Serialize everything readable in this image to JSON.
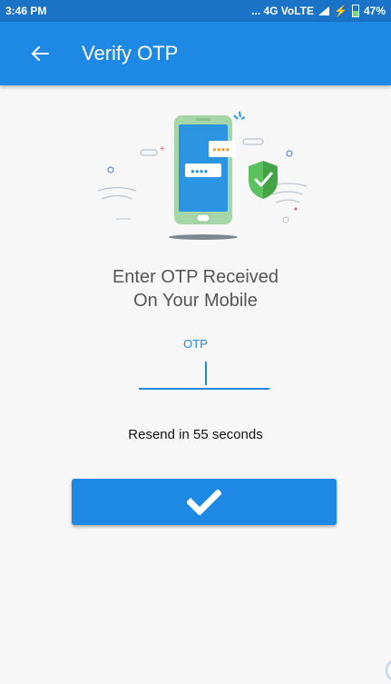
{
  "status_bar": {
    "time": "3:46 PM",
    "network": "... 4G VoLTE",
    "battery": "47%"
  },
  "app_bar": {
    "back_icon": "arrow-left-icon",
    "title": "Verify OTP"
  },
  "illustration": {
    "icon": "phone-otp-shield-illustration"
  },
  "headline": {
    "line1": "Enter OTP Received",
    "line2": "On Your Mobile"
  },
  "otp": {
    "label": "OTP",
    "value": ""
  },
  "resend_text": "Resend in 55 seconds",
  "submit": {
    "icon": "checkmark-icon"
  },
  "colors": {
    "primary": "#1e88e5",
    "status_bar": "#1a73c7",
    "background": "#f7f7f7"
  }
}
